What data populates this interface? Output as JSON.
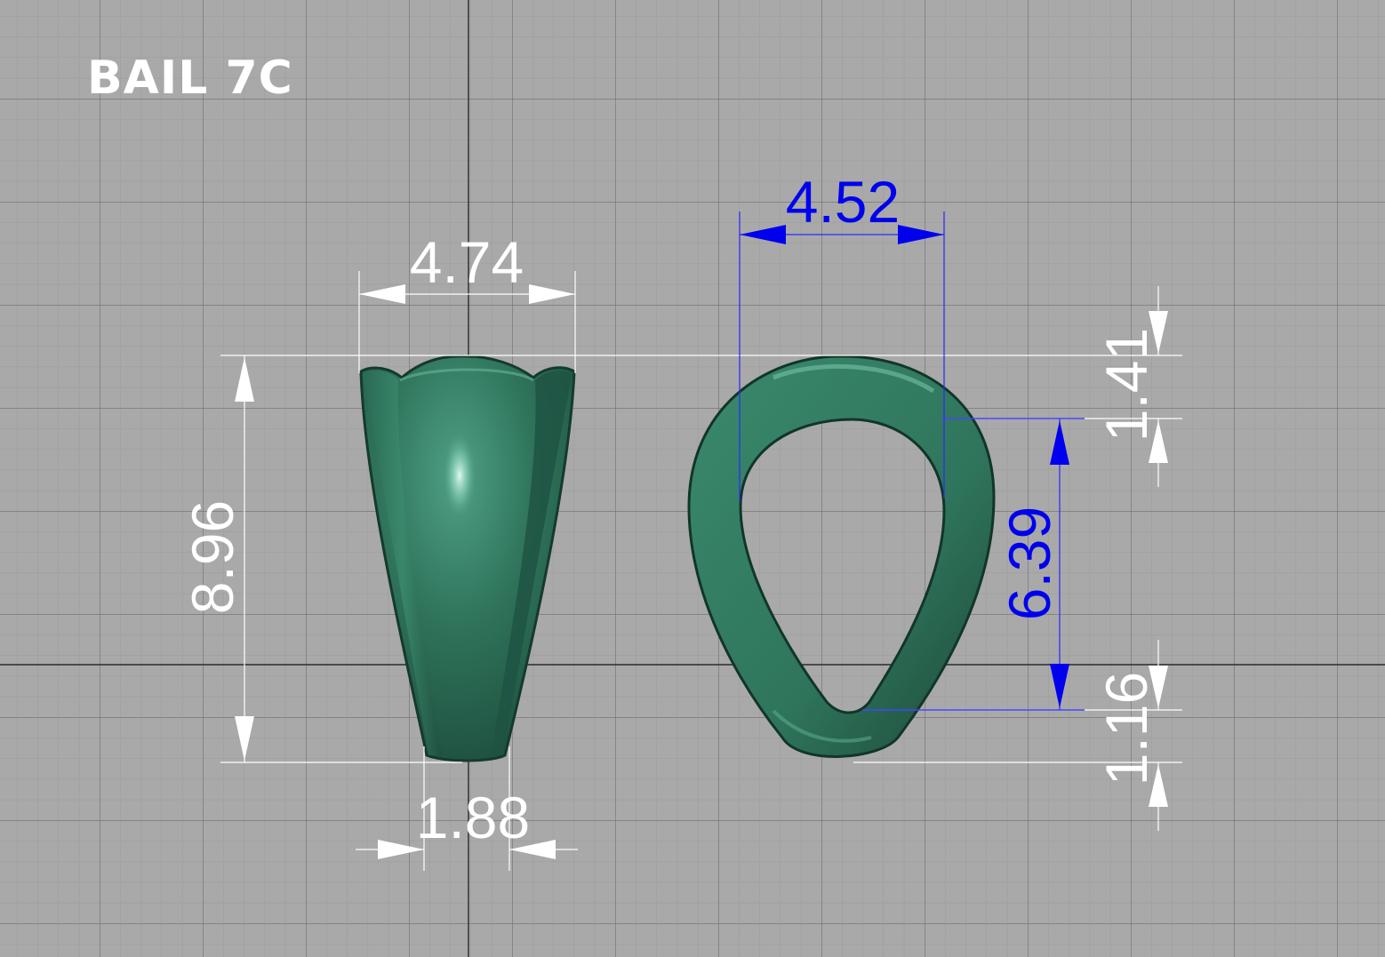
{
  "title": "BAIL 7C",
  "colors": {
    "background": "#a9a9a9",
    "grid_minor": "#9a9a9a",
    "grid_major": "#6e6e6e",
    "axis": "#2a2a2a",
    "part": "#2e7058",
    "dim_white": "#ffffff",
    "dim_blue": "#0000ee"
  },
  "front_view": {
    "top_width": "4.74",
    "height": "8.96",
    "bottom_width": "1.88"
  },
  "side_view": {
    "opening_width": "4.52",
    "opening_height": "6.39",
    "top_thickness": "1.41",
    "bottom_thickness": "1.16"
  }
}
